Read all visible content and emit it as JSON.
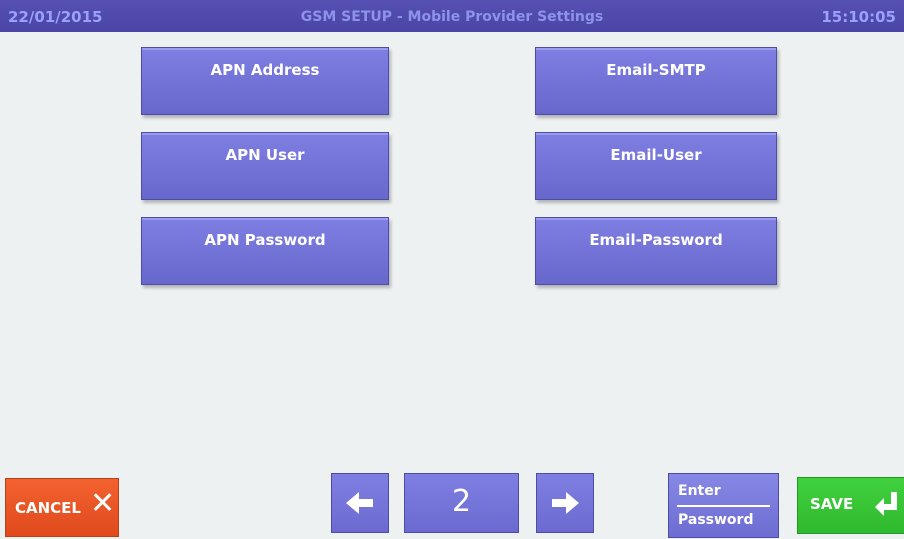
{
  "header": {
    "date": "22/01/2015",
    "title": "GSM SETUP - Mobile Provider Settings",
    "time": "15:10:05"
  },
  "settings": {
    "apn_address": "APN Address",
    "apn_user": "APN User",
    "apn_password": "APN Password",
    "email_smtp": "Email-SMTP",
    "email_user": "Email-User",
    "email_password": "Email-Password"
  },
  "footer": {
    "cancel_label": "CANCEL",
    "cancel_icon": "close-icon",
    "prev_icon": "arrow-left-icon",
    "page_number": "2",
    "next_icon": "arrow-right-icon",
    "enter_line1": "Enter",
    "enter_line2": "Password",
    "save_label": "SAVE",
    "save_icon": "enter-return-icon"
  },
  "colors": {
    "titlebar": "#4a45a6",
    "button": "#7373d8",
    "cancel": "#e8521f",
    "save": "#36c234",
    "background": "#eef1f2"
  }
}
